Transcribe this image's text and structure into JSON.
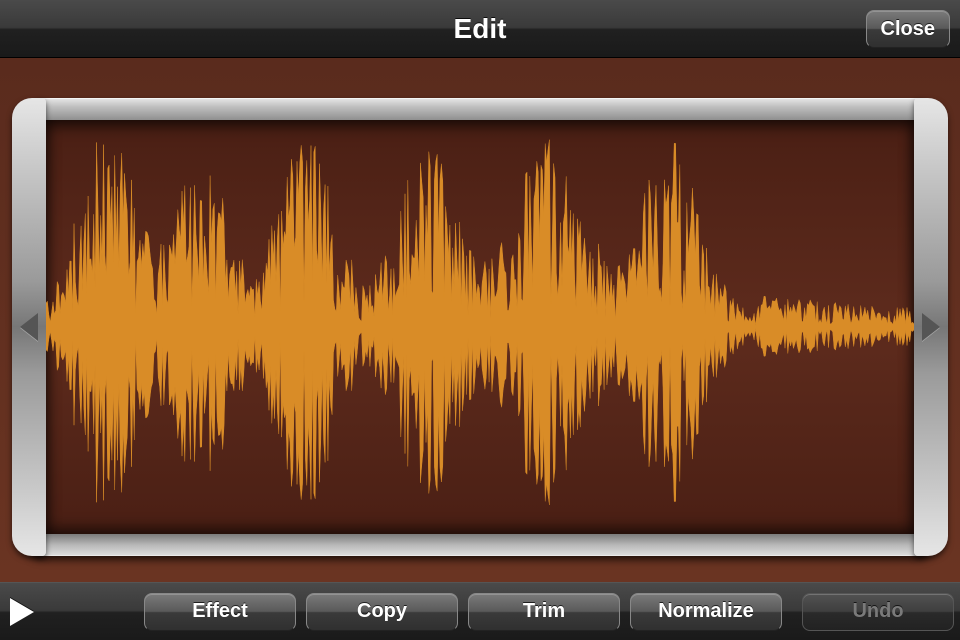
{
  "navbar": {
    "title": "Edit",
    "close_label": "Close"
  },
  "waveform": {
    "color": "#d98c27",
    "bg": "#5c2a1c",
    "left_arrow": "left-trim-handle",
    "right_arrow": "right-trim-handle"
  },
  "toolbar": {
    "play_label": "Play",
    "effect_label": "Effect",
    "copy_label": "Copy",
    "trim_label": "Trim",
    "normalize_label": "Normalize",
    "undo_label": "Undo",
    "undo_enabled": false
  }
}
